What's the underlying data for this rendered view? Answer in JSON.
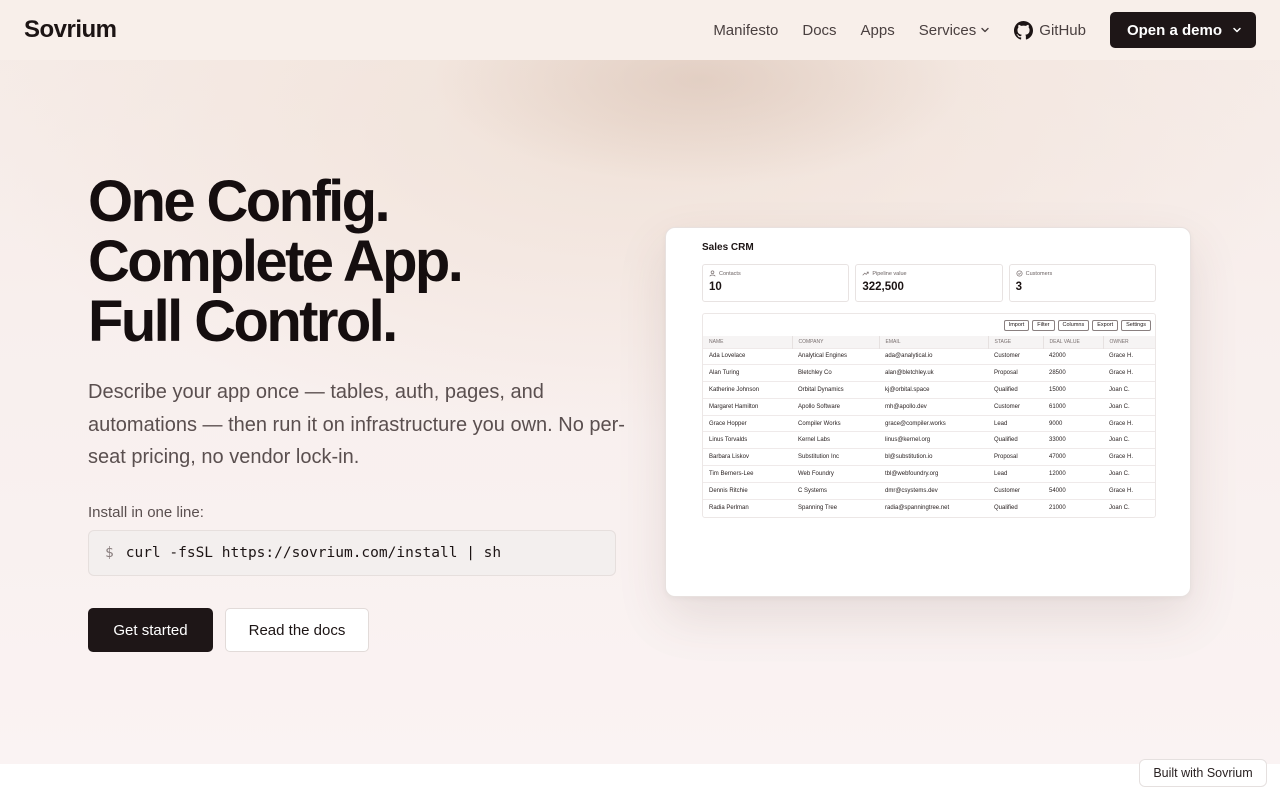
{
  "nav": {
    "logo": "Sovrium",
    "links": [
      "Manifesto",
      "Docs",
      "Apps",
      "Services"
    ],
    "github": "GitHub",
    "demo": "Open a demo",
    "icons": {
      "github": "github-icon",
      "chevron": "chevron-down-icon"
    }
  },
  "hero": {
    "headline": [
      "One Config.",
      "Complete App.",
      "Full Control."
    ],
    "description": "Describe your app once — tables, auth, pages, and automations — then run it on infrastructure you own. No per-seat pricing, no vendor lock-in.",
    "install_label": "Install in one line:",
    "prompt": "$",
    "command": "curl -fsSL https://sovrium.com/install | sh",
    "primary_cta": "Get started",
    "secondary_cta": "Read the docs"
  },
  "preview": {
    "title": "Sales CRM",
    "stats": [
      {
        "label": "Contacts",
        "value": "10",
        "icon": "users-icon"
      },
      {
        "label": "Pipeline value",
        "value": "322,500",
        "icon": "trend-up-icon"
      },
      {
        "label": "Customers",
        "value": "3",
        "icon": "check-circle-icon"
      }
    ],
    "toolbar": [
      "Import",
      "Filter",
      "Columns",
      "Export",
      "Settings"
    ],
    "columns": [
      "Name",
      "Company",
      "Email",
      "Stage",
      "Deal value",
      "Owner"
    ],
    "rows": [
      [
        "Ada Lovelace",
        "Analytical Engines",
        "ada@analytical.io",
        "Customer",
        "42000",
        "Grace H."
      ],
      [
        "Alan Turing",
        "Bletchley Co",
        "alan@bletchley.uk",
        "Proposal",
        "28500",
        "Grace H."
      ],
      [
        "Katherine Johnson",
        "Orbital Dynamics",
        "kj@orbital.space",
        "Qualified",
        "15000",
        "Joan C."
      ],
      [
        "Margaret Hamilton",
        "Apollo Software",
        "mh@apollo.dev",
        "Customer",
        "61000",
        "Joan C."
      ],
      [
        "Grace Hopper",
        "Compiler Works",
        "grace@compiler.works",
        "Lead",
        "9000",
        "Grace H."
      ],
      [
        "Linus Torvalds",
        "Kernel Labs",
        "linus@kernel.org",
        "Qualified",
        "33000",
        "Joan C."
      ],
      [
        "Barbara Liskov",
        "Substitution Inc",
        "bl@substitution.io",
        "Proposal",
        "47000",
        "Grace H."
      ],
      [
        "Tim Berners-Lee",
        "Web Foundry",
        "tbl@webfoundry.org",
        "Lead",
        "12000",
        "Joan C."
      ],
      [
        "Dennis Ritchie",
        "C Systems",
        "dmr@csystems.dev",
        "Customer",
        "54000",
        "Grace H."
      ],
      [
        "Radia Perlman",
        "Spanning Tree",
        "radia@spanningtree.net",
        "Qualified",
        "21000",
        "Joan C."
      ]
    ]
  },
  "badge": "Built with Sovrium"
}
